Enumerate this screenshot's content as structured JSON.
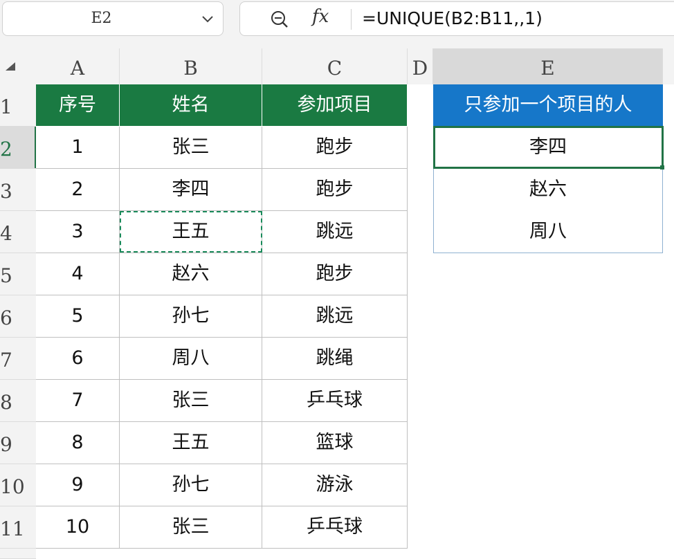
{
  "namebox": {
    "value": "E2"
  },
  "formula_bar": {
    "formula": "=UNIQUE(B2:B11,,1)",
    "fx_label": "fx"
  },
  "columns": [
    "A",
    "B",
    "C",
    "D",
    "E"
  ],
  "rows": [
    "1",
    "2",
    "3",
    "4",
    "5",
    "6",
    "7",
    "8",
    "9",
    "10",
    "11"
  ],
  "table": {
    "headers": [
      "序号",
      "姓名",
      "参加项目"
    ],
    "rows": [
      [
        "1",
        "张三",
        "跑步"
      ],
      [
        "2",
        "李四",
        "跑步"
      ],
      [
        "3",
        "王五",
        "跳远"
      ],
      [
        "4",
        "赵六",
        "跑步"
      ],
      [
        "5",
        "孙七",
        "跳远"
      ],
      [
        "6",
        "周八",
        "跳绳"
      ],
      [
        "7",
        "张三",
        "乒乓球"
      ],
      [
        "8",
        "王五",
        "篮球"
      ],
      [
        "9",
        "孙七",
        "游泳"
      ],
      [
        "10",
        "张三",
        "乒乓球"
      ]
    ]
  },
  "result": {
    "header": "只参加一个项目的人",
    "values": [
      "李四",
      "赵六",
      "周八"
    ]
  },
  "colors": {
    "header_green": "#1a7a42",
    "header_blue": "#1677c9",
    "selection": "#217346"
  },
  "icons": {
    "zoom": "zoom-out-icon",
    "dropdown": "chevron-down-icon",
    "select_all": "select-all-triangle-icon"
  }
}
